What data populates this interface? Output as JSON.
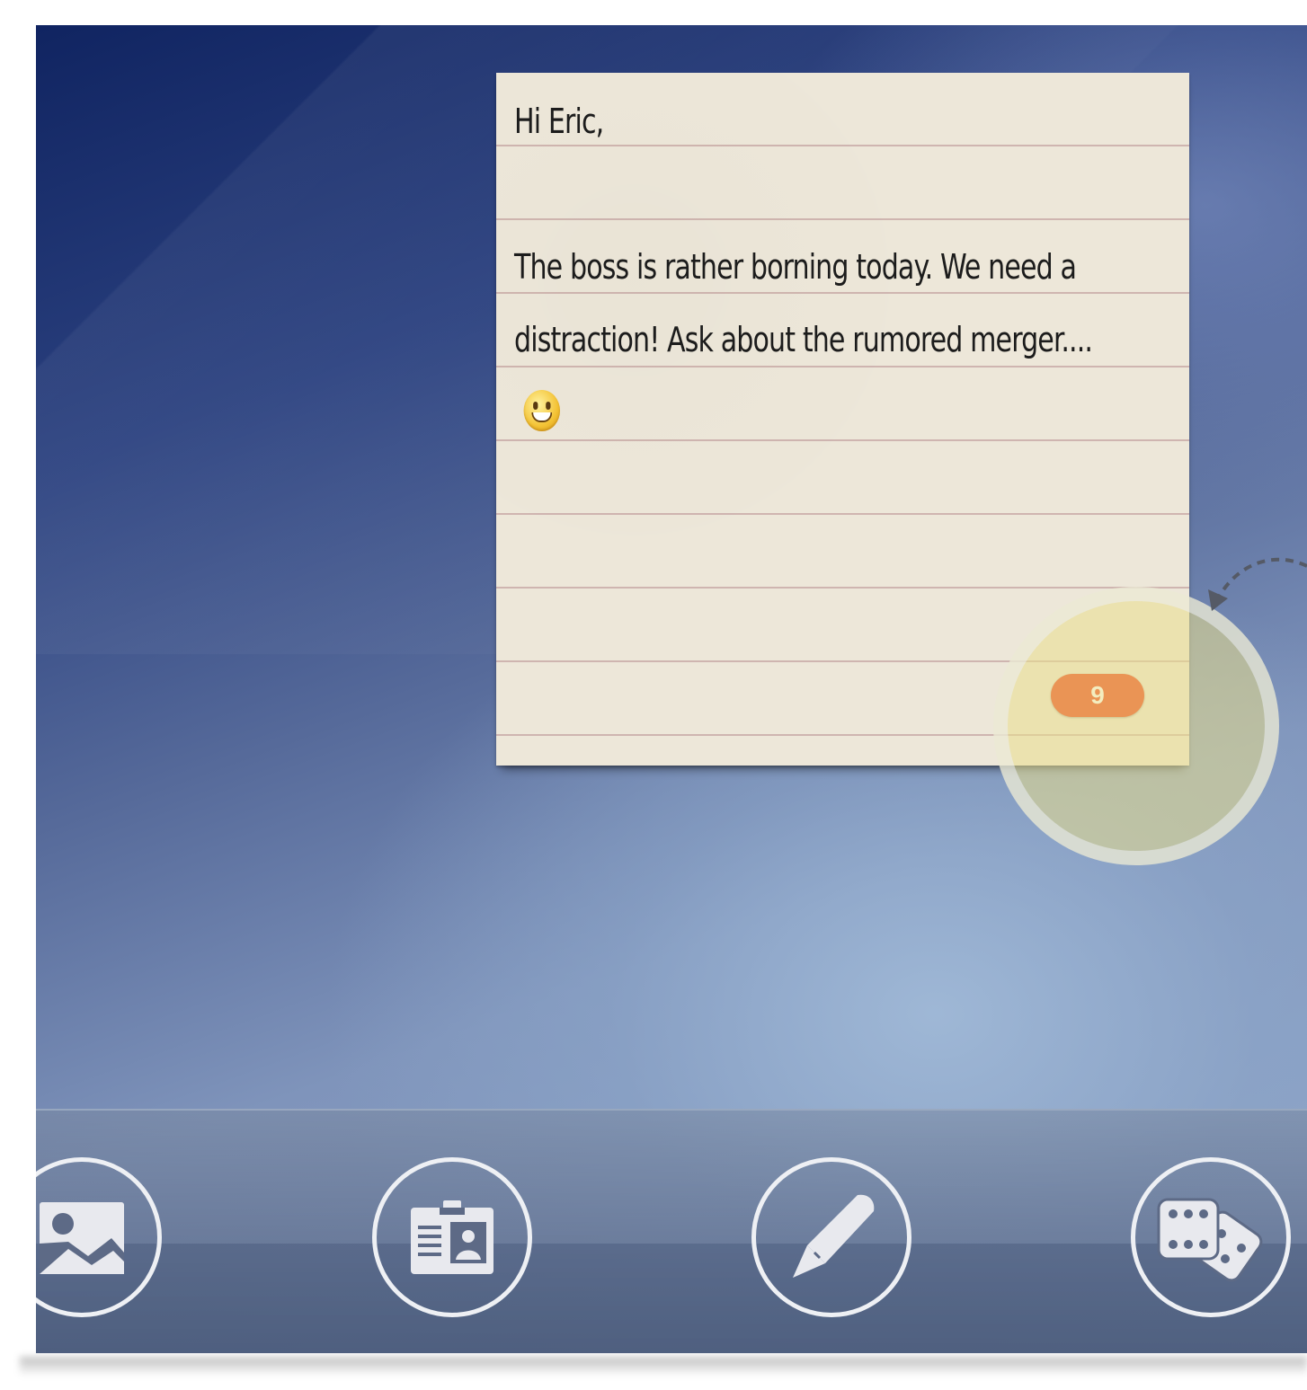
{
  "note": {
    "greeting": "Hi Eric,",
    "body": "The boss is rather borning today. We need a distraction! Ask about the rumored merger....",
    "emoji": "smiling-face-emoji",
    "badge_count": "9",
    "paper_color": "#ede7d9",
    "badge_color": "#ec3b12"
  },
  "dock": {
    "items": [
      {
        "label": "photos",
        "icon": "image-icon"
      },
      {
        "label": "contacts",
        "icon": "id-badge-icon"
      },
      {
        "label": "notes",
        "icon": "pen-icon"
      },
      {
        "label": "games",
        "icon": "dice-icon"
      }
    ]
  },
  "callout": {
    "highlight_color": "#e9de8c",
    "pointer": "dashed-arrow-icon"
  }
}
